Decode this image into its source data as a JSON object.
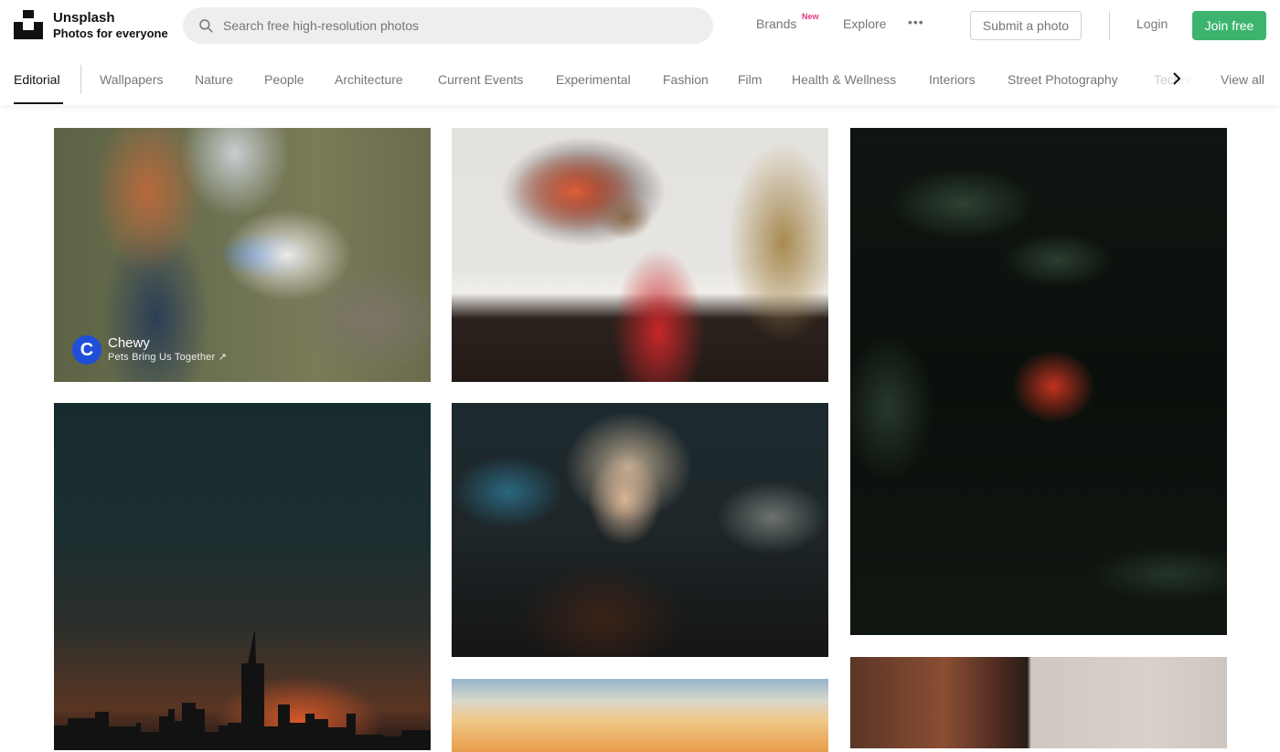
{
  "header": {
    "brand_name": "Unsplash",
    "brand_tagline": "Photos for everyone",
    "search_placeholder": "Search free high-resolution photos",
    "search_value": "",
    "nav": {
      "brands_label": "Brands",
      "brands_badge": "New",
      "explore_label": "Explore",
      "more_label": "•••",
      "submit_label": "Submit a photo",
      "login_label": "Login",
      "join_label": "Join free"
    },
    "colors": {
      "join_button": "#3cb46e",
      "new_badge": "#e3377f"
    }
  },
  "categories": {
    "active": "Editorial",
    "items": [
      "Editorial",
      "Wallpapers",
      "Nature",
      "People",
      "Architecture",
      "Current Events",
      "Experimental",
      "Fashion",
      "Film",
      "Health & Wellness",
      "Interiors",
      "Street Photography"
    ],
    "truncated_item": "Technology",
    "view_all_label": "View all"
  },
  "photos": [
    {
      "subject": "Person holding blue dog toy for white dog near waterfall",
      "sponsored": true,
      "sponsor": {
        "name": "Chewy",
        "avatar_letter": "C",
        "tagline": "Pets Bring Us Together",
        "link_icon": "↗",
        "color": "#1f4ed8"
      }
    },
    {
      "subject": "Child in red plaid shirt at table with fireplace TV and Christmas tree"
    },
    {
      "subject": "Red berries hanging among dark green leaves"
    },
    {
      "subject": "City skyline silhouette at sunset"
    },
    {
      "subject": "Woman with windswept blonde hair in dark coat"
    },
    {
      "subject": "Sunset sky over horizon"
    },
    {
      "subject": "Rusty perforated metal building facade"
    }
  ]
}
